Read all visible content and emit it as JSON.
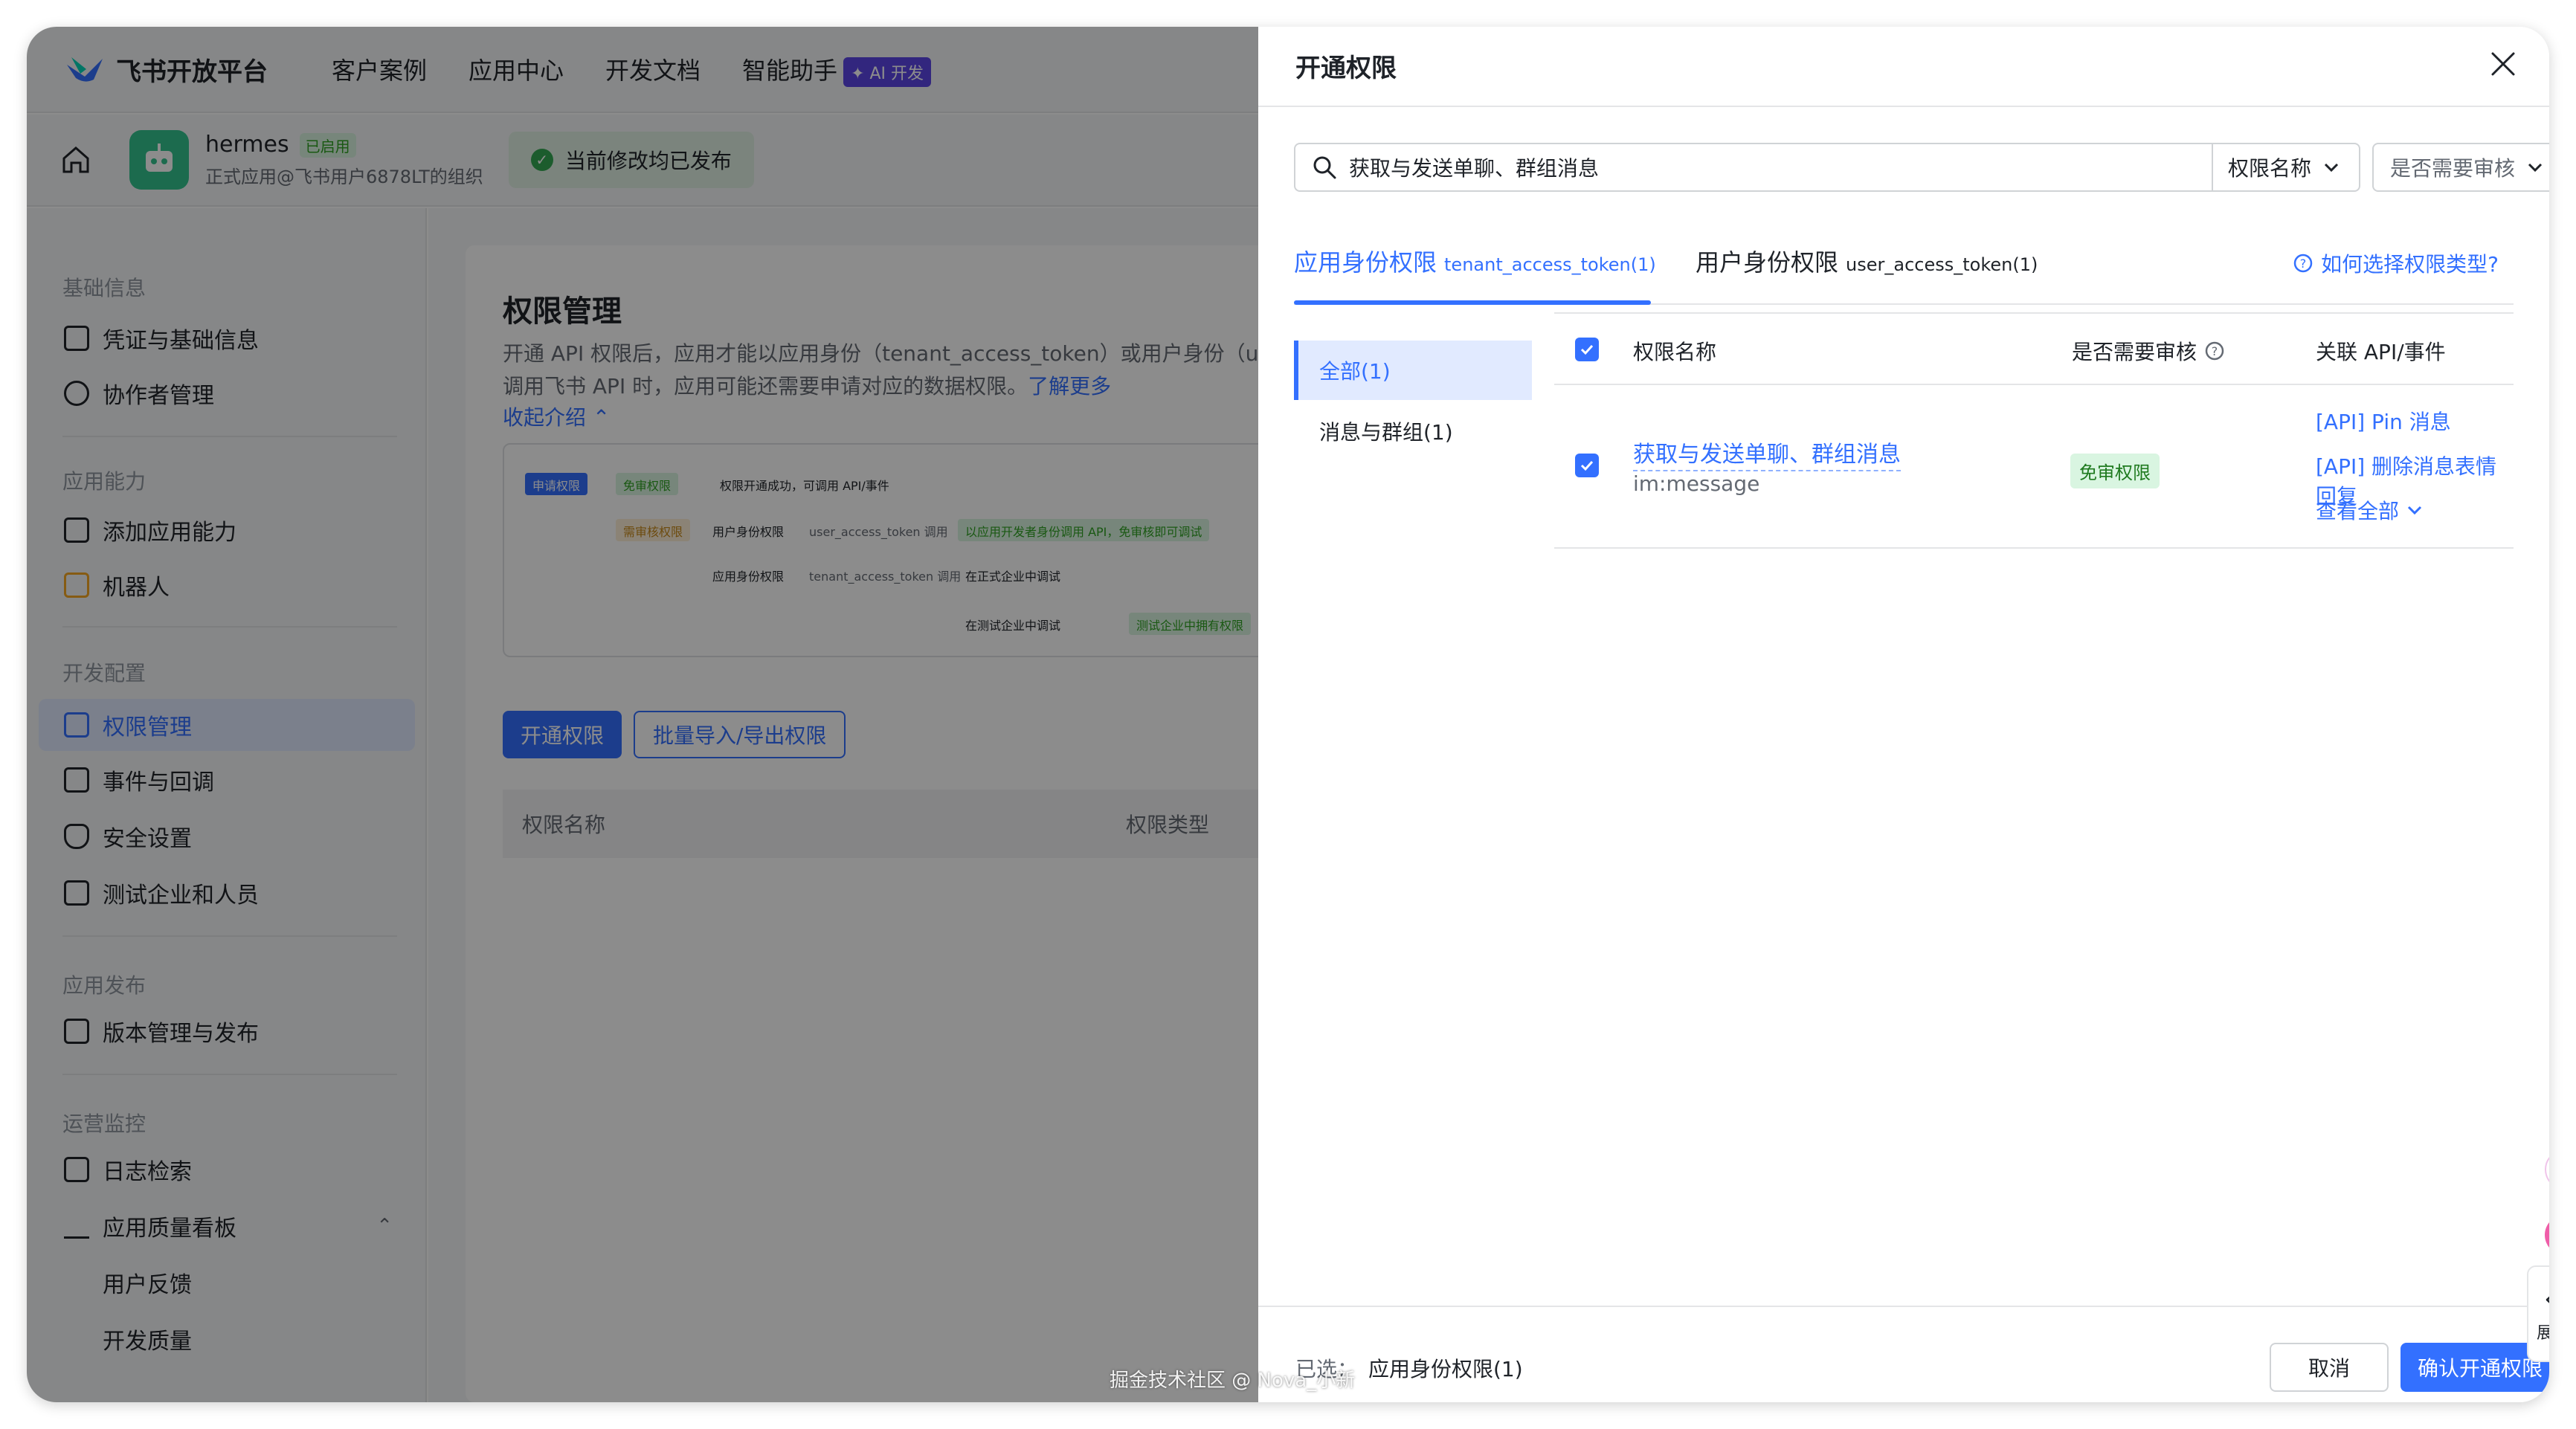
{
  "topnav": {
    "brand": "飞书开放平台",
    "items": [
      "客户案例",
      "应用中心",
      "开发文档",
      "智能助手"
    ],
    "ai_badge": "✦ AI 开发"
  },
  "appbar": {
    "app_name": "hermes",
    "app_status": "已启用",
    "app_org": "正式应用@飞书用户6878LT的组织",
    "publish_status": "当前修改均已发布"
  },
  "sidebar": {
    "groups": [
      "基础信息",
      "应用能力",
      "开发配置",
      "应用发布",
      "运营监控"
    ],
    "items": [
      "凭证与基础信息",
      "协作者管理",
      "添加应用能力",
      "机器人",
      "权限管理",
      "事件与回调",
      "安全设置",
      "测试企业和人员",
      "版本管理与发布",
      "日志检索",
      "应用质量看板",
      "用户反馈",
      "开发质量"
    ]
  },
  "content": {
    "title": "权限管理",
    "desc_part1": "开通 API 权限后，应用才能以应用身份（tenant_access_token）或用户身份（u",
    "desc_part2": "调用飞书 API 时，应用可能还需要申请对应的数据权限。",
    "learn_more": "了解更多",
    "collapse": "收起介绍",
    "flow": [
      "申请权限",
      "免审权限",
      "权限开通成功，可调用 API/事件",
      "需审核权限",
      "用户身份权限",
      "user_access_token 调用",
      "以应用开发者身份调用 API，免审核即可调试",
      "应用身份权限",
      "tenant_access_token 调用",
      "在正式企业中调试",
      "在测试企业中调试",
      "测试企业中拥有权限"
    ],
    "btn_open": "开通权限",
    "btn_batch": "批量导入/导出权限",
    "col_name": "权限名称",
    "col_type": "权限类型"
  },
  "drawer": {
    "title": "开通权限",
    "search_value": "获取与发送单聊、群组消息",
    "select_field": "权限名称",
    "select_review": "是否需要审核",
    "tabs": [
      {
        "label": "应用身份权限",
        "sub": "tenant_access_token(1)"
      },
      {
        "label": "用户身份权限",
        "sub": "user_access_token(1)"
      }
    ],
    "help_link": "如何选择权限类型?",
    "categories": [
      "全部(1)",
      "消息与群组(1)"
    ],
    "table": {
      "headers": [
        "权限名称",
        "是否需要审核",
        "关联 API/事件"
      ],
      "rows": [
        {
          "name": "获取与发送单聊、群组消息",
          "code": "im:message",
          "review": "免审权限",
          "apis": [
            "[API] Pin 消息",
            "[API] 删除消息表情回复"
          ],
          "view_all": "查看全部"
        }
      ]
    },
    "footer": {
      "selected_label": "已选：",
      "selected_value": "应用身份权限(1)",
      "cancel": "取消",
      "confirm": "确认开通权限"
    },
    "watermark": "掘金技术社区 @ Nova_小新"
  },
  "float": {
    "expand": "展开",
    "arrows": "«"
  },
  "colors": {
    "primary": "#3370ff",
    "success": "#34c38f",
    "active_bg": "#e1eaff",
    "overlay": "rgba(0,0,0,0.45)"
  }
}
